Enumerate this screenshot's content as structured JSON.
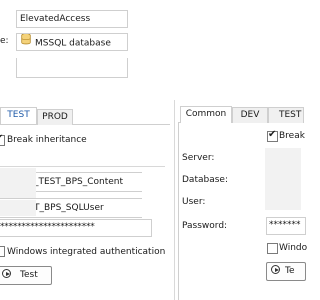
{
  "top": {
    "alias_value": "ElevatedAccess",
    "type_label_fragment": "e:",
    "type_value": "MSSQL database"
  },
  "left_panel": {
    "tabs": [
      {
        "label": "TEST",
        "active": true
      },
      {
        "label": "PROD",
        "active": false
      }
    ],
    "break_inheritance_label": "Break inheritance",
    "database_value": "_TEST_BPS_Content",
    "user_value": "T_BPS_SQLUser",
    "password_value": "**********************",
    "windows_auth_label": "Windows integrated authentication",
    "test_button_label": "Test"
  },
  "right_panel": {
    "tabs": [
      {
        "label": "Common",
        "active": true
      },
      {
        "label": "DEV",
        "active": false
      },
      {
        "label": "TEST",
        "active": false
      }
    ],
    "break_label": "Break",
    "server_label": "Server:",
    "database_label": "Database:",
    "user_label": "User:",
    "password_label": "Password:",
    "password_value": "*******",
    "windows_label": "Windo",
    "test_button_label": "Te"
  }
}
